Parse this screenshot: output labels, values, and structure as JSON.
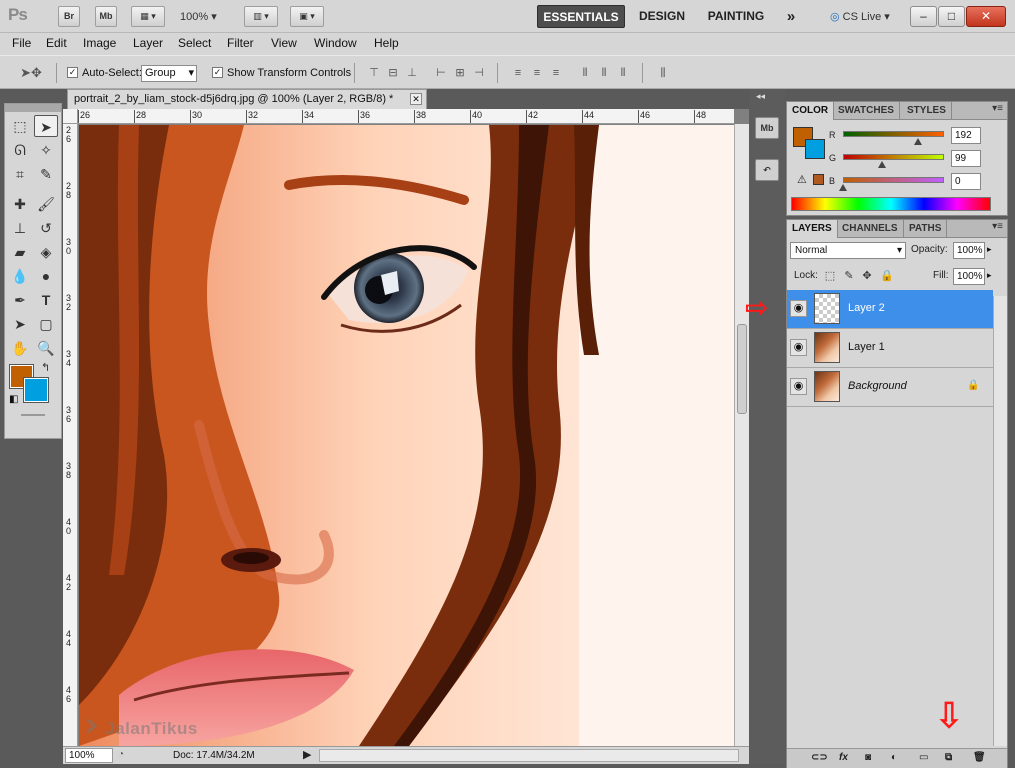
{
  "app": {
    "logo": "Ps",
    "bridge_label": "Br",
    "minibridge_label": "Mb",
    "zoom": "100%",
    "workspaces": [
      "ESSENTIALS",
      "DESIGN",
      "PAINTING"
    ],
    "more_workspaces": "»",
    "cs_live": "CS Live",
    "win_minimize": "–",
    "win_restore": "□",
    "win_close": "✕"
  },
  "menu": [
    "File",
    "Edit",
    "Image",
    "Layer",
    "Select",
    "Filter",
    "View",
    "Window",
    "Help"
  ],
  "options": {
    "auto_select_label": "Auto-Select:",
    "auto_select_value": "Group",
    "show_transform_label": "Show Transform Controls",
    "checked": "✓"
  },
  "document": {
    "tab_title": "portrait_2_by_liam_stock-d5j6drq.jpg @ 100% (Layer 2, RGB/8) *",
    "close": "✕",
    "ruler_top": [
      "26",
      "28",
      "30",
      "32",
      "34",
      "36",
      "38",
      "40",
      "42",
      "44",
      "46",
      "48"
    ],
    "ruler_left": [
      "2 6",
      "2 8",
      "3 0",
      "3 2",
      "3 4",
      "3 6",
      "3 8",
      "4 0",
      "4 2",
      "4 4",
      "4 6"
    ],
    "status_zoom": "100%",
    "status_doc": "Doc: 17.4M/34.2M"
  },
  "color_panel": {
    "tabs": [
      "COLOR",
      "SWATCHES",
      "STYLES"
    ],
    "r_label": "R",
    "r_value": "192",
    "g_label": "G",
    "g_value": "99",
    "b_label": "B",
    "b_value": "0",
    "fg_color": "#c06000",
    "bg_color": "#00a0e0"
  },
  "layers_panel": {
    "tabs": [
      "LAYERS",
      "CHANNELS",
      "PATHS"
    ],
    "blend_mode": "Normal",
    "opacity_label": "Opacity:",
    "opacity_value": "100%",
    "lock_label": "Lock:",
    "fill_label": "Fill:",
    "fill_value": "100%",
    "layers": [
      {
        "name": "Layer 2",
        "selected": true
      },
      {
        "name": "Layer 1",
        "selected": false
      },
      {
        "name": "Background",
        "selected": false,
        "locked": true
      }
    ],
    "footer_icons": [
      "link-icon",
      "fx-icon",
      "mask-icon",
      "adjustment-icon",
      "group-icon",
      "new-layer-icon",
      "trash-icon"
    ],
    "fx_label": "fx"
  },
  "watermark": "JalanTikus"
}
